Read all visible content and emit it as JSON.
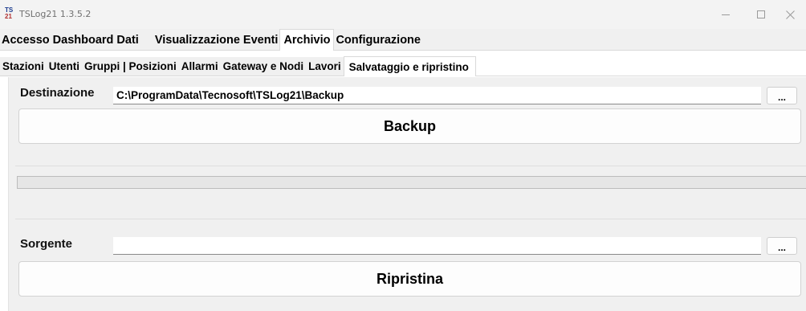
{
  "window": {
    "logo_top": "TS",
    "logo_bottom": "21",
    "title": "TSLog21",
    "version": "1.3.5.2"
  },
  "main_tabs": [
    {
      "label": "Accesso"
    },
    {
      "label": "Dashboard"
    },
    {
      "label": "Dati"
    },
    {
      "label": "Visualizzazione"
    },
    {
      "label": "Eventi"
    },
    {
      "label": "Archivio"
    },
    {
      "label": "Configurazione"
    }
  ],
  "main_active_tab": "Archivio",
  "sub_tabs": [
    {
      "label": "Stazioni"
    },
    {
      "label": "Utenti"
    },
    {
      "label": "Gruppi | Posizioni"
    },
    {
      "label": "Allarmi"
    },
    {
      "label": "Gateway e Nodi"
    },
    {
      "label": "Lavori"
    },
    {
      "label": "Salvataggio e ripristino"
    }
  ],
  "sub_active_tab": "Salvataggio e ripristino",
  "backup": {
    "label": "Destinazione",
    "path": "C:\\ProgramData\\Tecnosoft\\TSLog21\\Backup",
    "browse_label": "...",
    "button_label": "Backup"
  },
  "progress": {
    "value": 0
  },
  "restore": {
    "label": "Sorgente",
    "path": "",
    "browse_label": "...",
    "button_label": "Ripristina"
  }
}
